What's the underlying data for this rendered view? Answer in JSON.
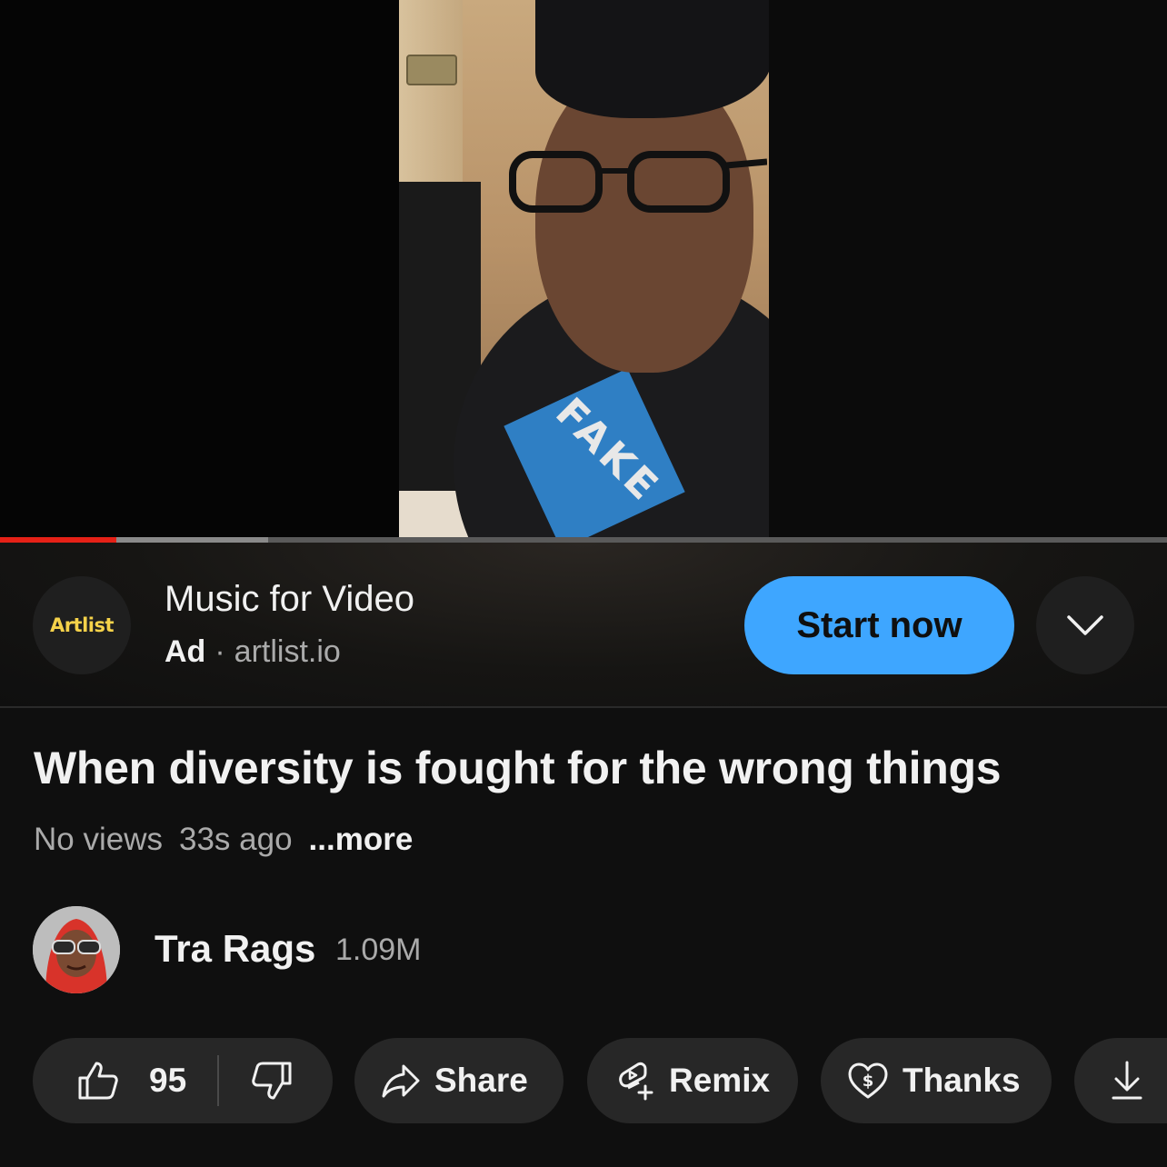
{
  "ad": {
    "logo_text": "Artlist",
    "title": "Music for Video",
    "label": "Ad",
    "separator": "·",
    "domain": "artlist.io",
    "cta": "Start now",
    "cta_color": "#3ea6ff",
    "expand_icon": "chevron-down-icon"
  },
  "player": {
    "progress_color": "#e62117",
    "played_fraction": 0.1,
    "buffered_fraction": 0.23,
    "shirt_print": "FAKE"
  },
  "video": {
    "title": "When diversity is fought for the wrong things",
    "views": "No views",
    "age": "33s ago",
    "more": "...more"
  },
  "channel": {
    "name": "Tra Rags",
    "subscribers": "1.09M"
  },
  "actions": {
    "likes": "95",
    "share": "Share",
    "remix": "Remix",
    "thanks": "Thanks",
    "icons": [
      "like-icon",
      "dislike-icon",
      "share-icon",
      "remix-icon",
      "thanks-icon",
      "download-icon"
    ]
  }
}
